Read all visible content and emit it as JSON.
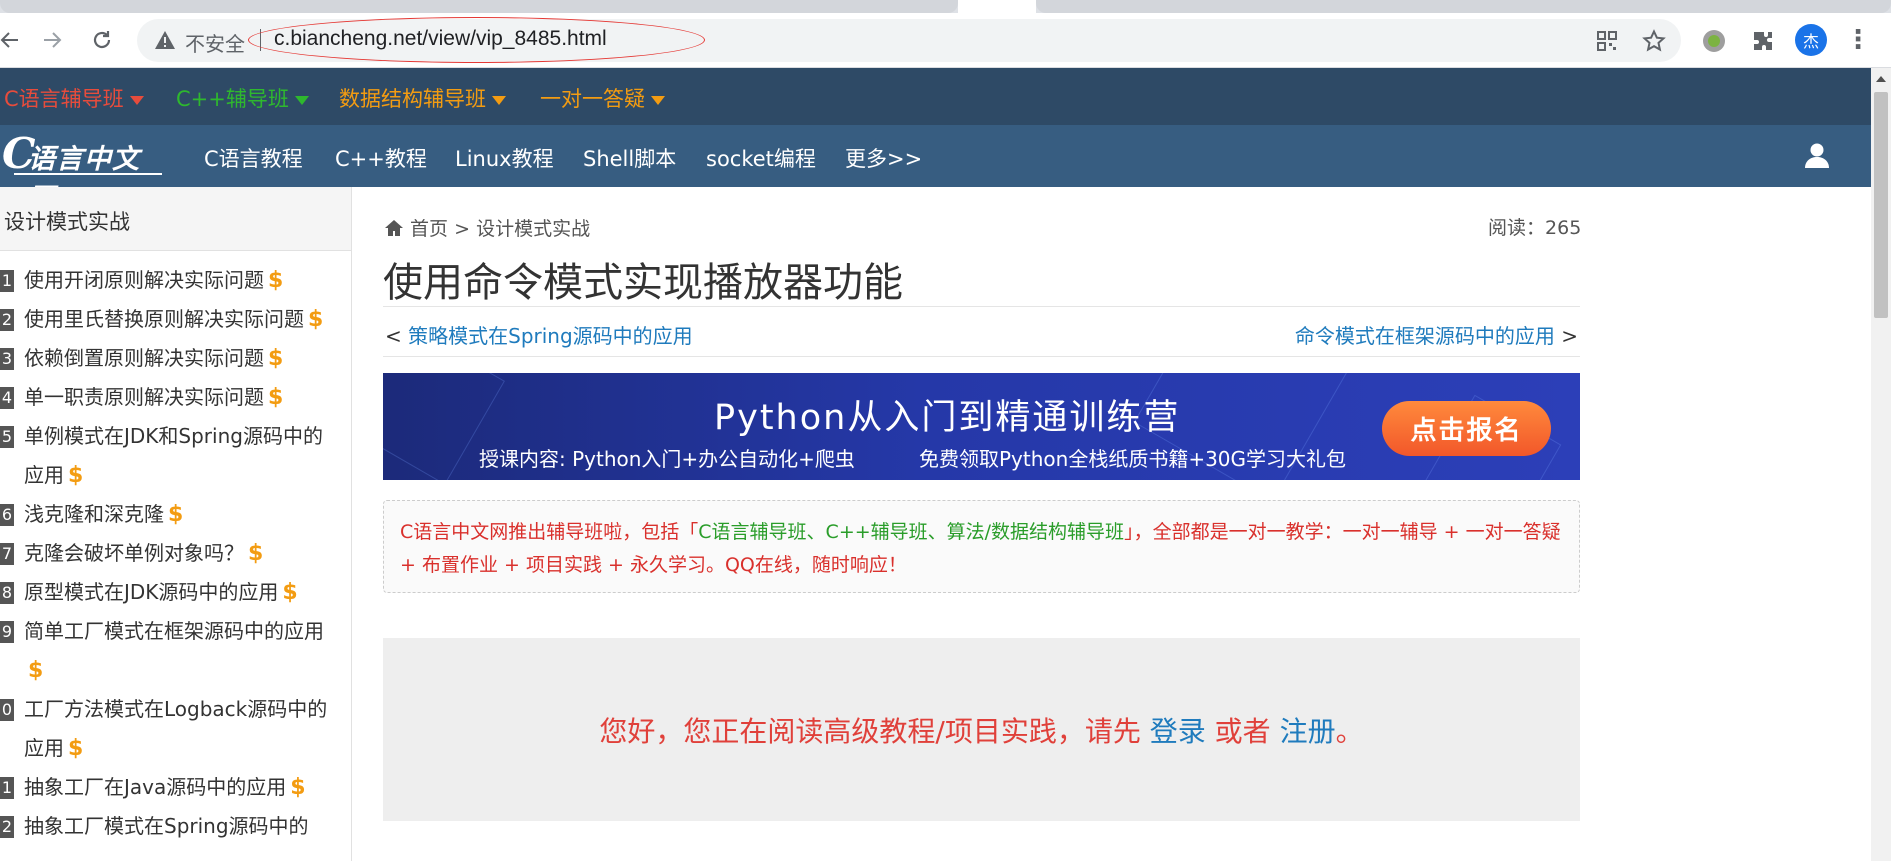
{
  "browser": {
    "insecure_label": "不安全",
    "url": "c.biancheng.net/view/vip_8485.html",
    "profile_initial": "杰"
  },
  "promo_bar": {
    "items": [
      {
        "label": "C语言辅导班",
        "color": "#e74c3c"
      },
      {
        "label": "C++辅导班",
        "color": "#2eb82e"
      },
      {
        "label": "数据结构辅导班",
        "color": "#f39c12"
      },
      {
        "label": "一对一答疑",
        "color": "#f39c12"
      }
    ]
  },
  "main_nav": {
    "logo_c": "C",
    "logo_rest": "语言中文网",
    "links": [
      "C语言教程",
      "C++教程",
      "Linux教程",
      "Shell脚本",
      "socket编程",
      "更多>>"
    ]
  },
  "sidebar": {
    "title": "设计模式实战",
    "items": [
      {
        "num": "1",
        "label": "使用开闭原则解决实际问题",
        "paid": "$"
      },
      {
        "num": "2",
        "label": "使用里氏替换原则解决实际问题",
        "paid": "$"
      },
      {
        "num": "3",
        "label": "依赖倒置原则解决实际问题",
        "paid": "$"
      },
      {
        "num": "4",
        "label": "单一职责原则解决实际问题",
        "paid": "$"
      },
      {
        "num": "5",
        "label": "单例模式在JDK和Spring源码中的应用",
        "paid": "$"
      },
      {
        "num": "6",
        "label": "浅克隆和深克隆",
        "paid": "$"
      },
      {
        "num": "7",
        "label": "克隆会破坏单例对象吗？",
        "paid": "$"
      },
      {
        "num": "8",
        "label": "原型模式在JDK源码中的应用",
        "paid": "$"
      },
      {
        "num": "9",
        "label": "简单工厂模式在框架源码中的应用",
        "paid": "$"
      },
      {
        "num": "0",
        "label": "工厂方法模式在Logback源码中的应用",
        "paid": "$"
      },
      {
        "num": "1",
        "label": "抽象工厂在Java源码中的应用",
        "paid": "$"
      },
      {
        "num": "2",
        "label": "抽象工厂模式在Spring源码中的",
        "paid": ""
      }
    ]
  },
  "content": {
    "breadcrumb": {
      "home": "首页",
      "sep": ">",
      "section": "设计模式实战"
    },
    "views_label": "阅读：",
    "views_count": "265",
    "title": "使用命令模式实现播放器功能",
    "prev": {
      "arrow": "<",
      "label": "策略模式在Spring源码中的应用"
    },
    "next": {
      "arrow": ">",
      "label": "命令模式在框架源码中的应用"
    },
    "banner": {
      "title": "Python从入门到精通训练营",
      "sub1": "授课内容: Python入门+办公自动化+爬虫",
      "sub2": "免费领取Python全栈纸质书籍+30G学习大礼包",
      "button": "点击报名"
    },
    "notice": {
      "part1": "C语言中文网推出辅导班啦，包括「",
      "green": "C语言辅导班、C++辅导班、算法/数据结构辅导班",
      "part2": "」，全部都是一对一教学：一对一辅导 + 一对一答疑 + 布置作业 + 项目实践 + 永久学习。QQ在线，随时响应！"
    },
    "login": {
      "prefix": "您好，您正在阅读高级教程/项目实践，请先 ",
      "login_link": "登录",
      "middle": " 或者 ",
      "register_link": "注册",
      "suffix": "。"
    }
  }
}
